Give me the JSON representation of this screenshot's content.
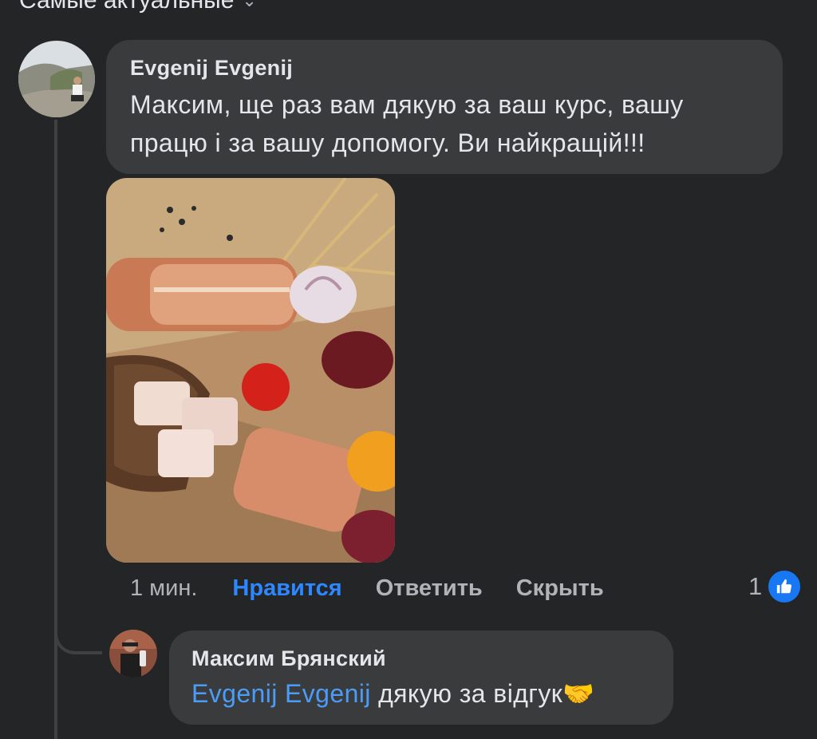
{
  "sort": {
    "label": "Самые актуальные",
    "icon": "chevron-down-icon"
  },
  "comment": {
    "author": "Evgenij Evgenij",
    "text": "Максим, ще раз вам дякую за ваш курс, вашу працю і за вашу допомогу. Ви найкращій!!!",
    "actions": {
      "time": "1 мин.",
      "like": "Нравится",
      "reply": "Ответить",
      "hide": "Скрыть"
    },
    "reaction_count": "1",
    "reaction_icon": "thumbs-up-icon"
  },
  "reply": {
    "author": "Максим Брянский",
    "mention": "Evgenij Evgenij",
    "text": " дякую за відгук🤝"
  },
  "colors": {
    "background": "#242526",
    "bubble": "#3a3b3c",
    "link": "#2d88ff",
    "mention": "#4b9cf7"
  }
}
